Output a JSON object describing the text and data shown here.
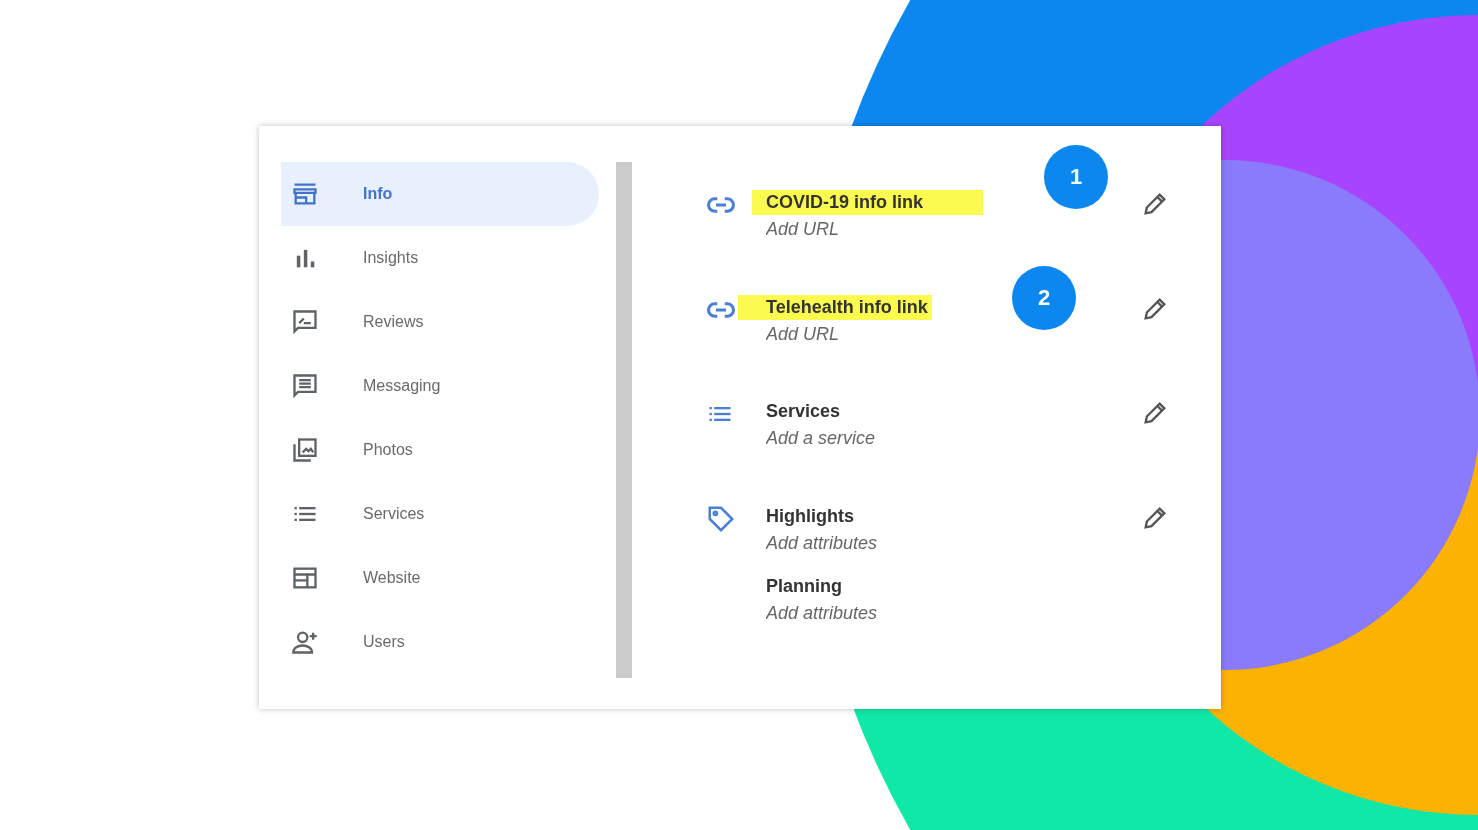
{
  "sidebar": {
    "items": [
      {
        "kind": "store",
        "label": "Info",
        "selected": true
      },
      {
        "kind": "chart",
        "label": "Insights",
        "selected": false
      },
      {
        "kind": "review",
        "label": "Reviews",
        "selected": false
      },
      {
        "kind": "message",
        "label": "Messaging",
        "selected": false
      },
      {
        "kind": "photos",
        "label": "Photos",
        "selected": false
      },
      {
        "kind": "list",
        "label": "Services",
        "selected": false
      },
      {
        "kind": "website",
        "label": "Website",
        "selected": false
      },
      {
        "kind": "user",
        "label": "Users",
        "selected": false
      }
    ]
  },
  "fields": [
    {
      "kind": "link",
      "title": "COVID-19 info link",
      "highlighted": true,
      "placeholder": "Add URL",
      "badge": "1",
      "editable": true
    },
    {
      "kind": "link",
      "title": "Telehealth info link",
      "highlighted": true,
      "placeholder": "Add URL",
      "badge": "2",
      "editable": true
    },
    {
      "kind": "list",
      "title": "Services",
      "highlighted": false,
      "placeholder": "Add a service",
      "editable": true
    },
    {
      "kind": "tag",
      "title": "Highlights",
      "highlighted": false,
      "placeholder": "Add attributes",
      "editable": true
    },
    {
      "kind": "plain",
      "title": "Planning",
      "highlighted": false,
      "placeholder": "Add attributes",
      "editable": false
    }
  ]
}
